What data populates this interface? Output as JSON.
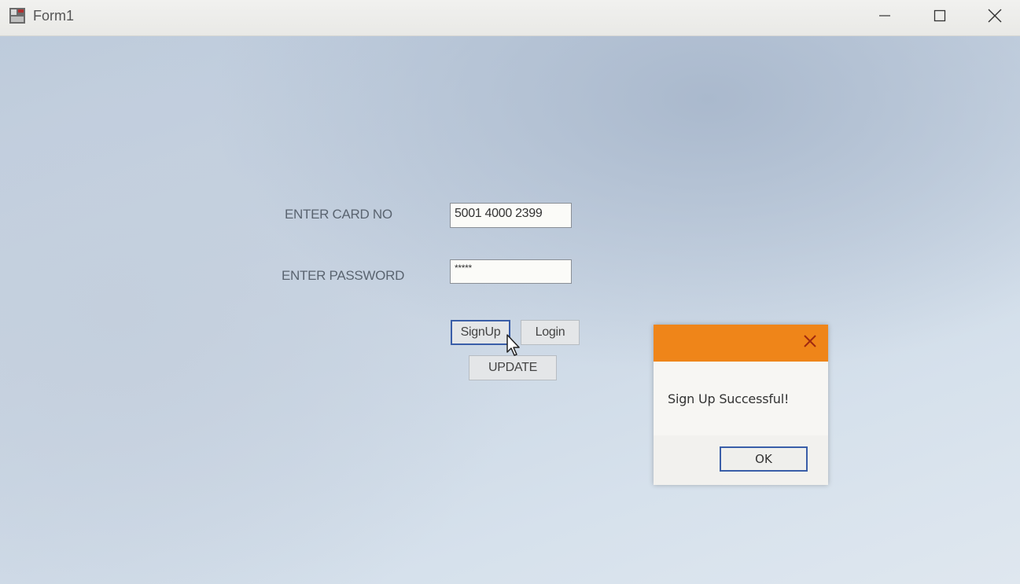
{
  "window": {
    "title": "Form1",
    "app_icon": "form-app-icon",
    "controls": {
      "minimize_icon": "minimize-icon",
      "maximize_icon": "maximize-icon",
      "close_icon": "close-icon"
    }
  },
  "form": {
    "card_label": "ENTER CARD NO",
    "card_value": "5001 4000 2399",
    "password_label": "ENTER PASSWORD",
    "password_value": "*****",
    "signup_label": "SignUp",
    "login_label": "Login",
    "update_label": "UPDATE"
  },
  "dialog": {
    "message": "Sign Up Successful!",
    "ok_label": "OK",
    "header_color": "#ef8519",
    "close_icon": "close-icon"
  },
  "colors": {
    "focus_border": "#3a5ea8",
    "dialog_header": "#ef8519"
  }
}
